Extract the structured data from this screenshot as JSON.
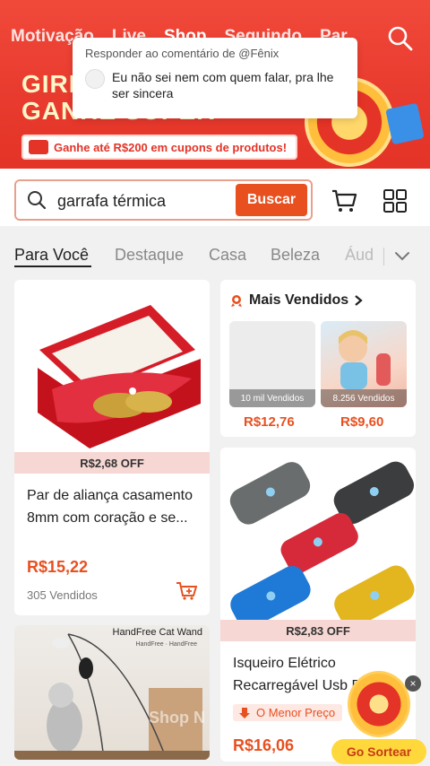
{
  "header": {
    "tabs": [
      "Motivação",
      "Live",
      "Shop",
      "Seguindo",
      "Par"
    ],
    "active_tab": "Shop",
    "promo_line1": "GIRE",
    "promo_line2": "GANHE SUPER",
    "coupon_text": "Ganhe até R$200 em cupons de produtos!"
  },
  "reply_popup": {
    "title": "Responder ao comentário de @Fênix",
    "text": "Eu não sei nem com quem falar, pra lhe ser sincera"
  },
  "search": {
    "query": "garrafa térmica",
    "button_label": "Buscar"
  },
  "categories": {
    "items": [
      "Para Você",
      "Destaque",
      "Casa",
      "Beleza",
      "Áud"
    ]
  },
  "products": {
    "ring": {
      "discount": "R$2,68 OFF",
      "title": "Par de aliança casamento 8mm com coração e se...",
      "price": "R$15,22",
      "sold": "305 Vendidos"
    },
    "best_sellers": {
      "title": "Mais Vendidos",
      "items": [
        {
          "sold": "10 mil Vendidos",
          "price": "R$12,76"
        },
        {
          "sold": "8.256 Vendidos",
          "price": "R$9,60"
        }
      ]
    },
    "lighter": {
      "discount": "R$2,83 OFF",
      "title": "Isqueiro Elétrico Recarregável Usb R...",
      "lowest_label": "O Menor Preço",
      "price": "R$16,06"
    },
    "cat_wand": {
      "title": "HandFree Cat Wand",
      "subtitle": "HandFree  ·  HandFree"
    }
  },
  "floating": {
    "button_label": "Go Sortear",
    "close": "×"
  },
  "watermark": "Shop N",
  "colors": {
    "brand": "#e8501f",
    "banner": "#e83a2e",
    "price": "#e8501f"
  }
}
